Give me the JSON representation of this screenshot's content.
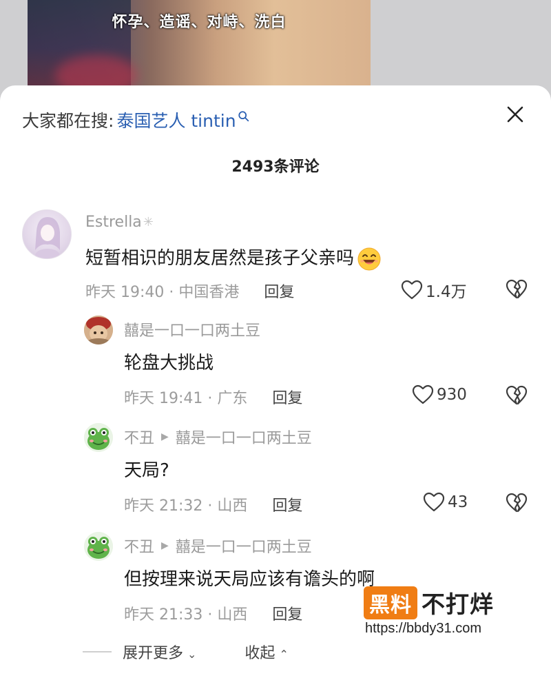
{
  "video": {
    "caption": "怀孕、造谣、对峙、洗白"
  },
  "search": {
    "prefix": "大家都在搜:",
    "term": "泰国艺人 tintin"
  },
  "comment_count": "2493条评论",
  "comments": [
    {
      "author": "Estrella",
      "text": "短暂相识的朋友居然是孩子父亲吗",
      "time_location": "昨天 19:40 · 中国香港",
      "reply_label": "回复",
      "likes": "1.4万"
    },
    {
      "author": "囍是一口一口两土豆",
      "text": "轮盘大挑战",
      "time_location": "昨天 19:41 · 广东",
      "reply_label": "回复",
      "likes": "930"
    },
    {
      "author": "不丑",
      "reply_to": "囍是一口一口两土豆",
      "text": "天局?",
      "time_location": "昨天 21:32 · 山西",
      "reply_label": "回复",
      "likes": "43"
    },
    {
      "author": "不丑",
      "reply_to": "囍是一口一口两土豆",
      "text": "但按理来说天局应该有谵头的啊",
      "time_location": "昨天 21:33 · 山西",
      "reply_label": "回复"
    }
  ],
  "footer": {
    "expand_label": "展开更多",
    "collapse_label": "收起"
  },
  "watermark": {
    "badge": "黑料",
    "text": "不打烊",
    "url": "https://bbdy31.com"
  },
  "colors": {
    "search_term": "#2a5fb2",
    "watermark_badge": "#f07d14"
  }
}
